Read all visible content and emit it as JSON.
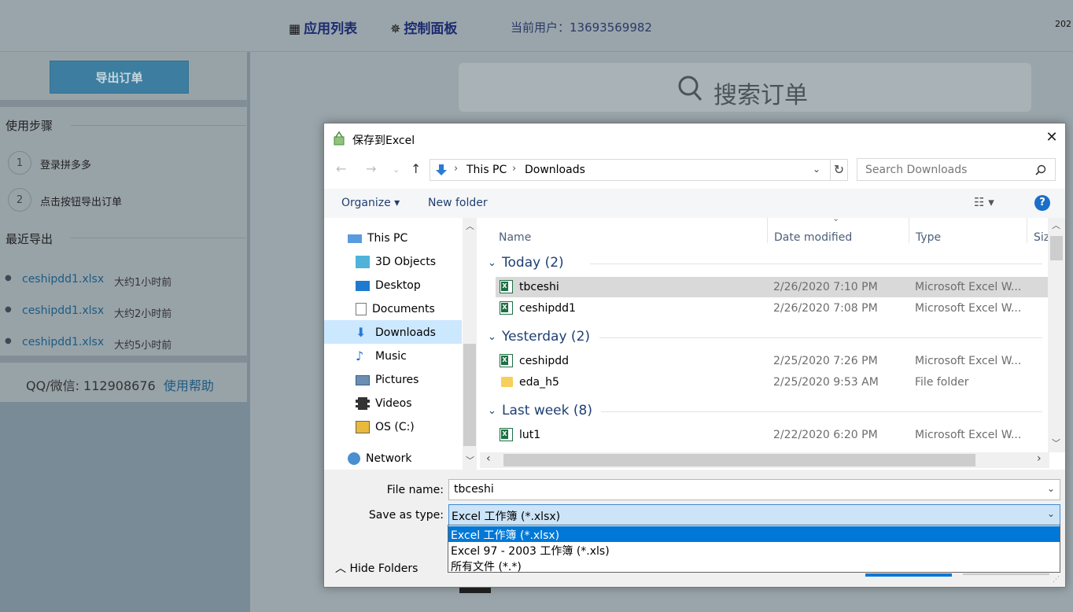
{
  "topbar": {
    "app_list": "应用列表",
    "control_panel": "控制面板",
    "user_label": "当前用户：13693569982",
    "date_clip": "202"
  },
  "sidebar": {
    "export_button": "导出订单",
    "steps_title": "使用步骤",
    "steps": [
      {
        "num": "1",
        "text": "登录拼多多"
      },
      {
        "num": "2",
        "text": "点击按钮导出订单"
      }
    ],
    "recent_title": "最近导出",
    "recent": [
      {
        "file": "ceshipdd1.xlsx",
        "time": "大约1小时前"
      },
      {
        "file": "ceshipdd1.xlsx",
        "time": "大约2小时前"
      },
      {
        "file": "ceshipdd1.xlsx",
        "time": "大约5小时前"
      }
    ],
    "contact": "QQ/微信: 112908676",
    "help": "使用帮助"
  },
  "main": {
    "search_placeholder": "搜索订单"
  },
  "dialog": {
    "title": "保存到Excel",
    "address": {
      "root": "This PC",
      "folder": "Downloads"
    },
    "search_placeholder": "Search Downloads",
    "toolbar": {
      "organize": "Organize ▾",
      "new_folder": "New folder",
      "help": "?"
    },
    "nav": [
      {
        "label": "This PC",
        "icon": "pc-icon"
      },
      {
        "label": "3D Objects",
        "icon": "cube-icon"
      },
      {
        "label": "Desktop",
        "icon": "desktop-icon"
      },
      {
        "label": "Documents",
        "icon": "document-icon"
      },
      {
        "label": "Downloads",
        "icon": "download-icon",
        "selected": true
      },
      {
        "label": "Music",
        "icon": "music-icon"
      },
      {
        "label": "Pictures",
        "icon": "pictures-icon"
      },
      {
        "label": "Videos",
        "icon": "videos-icon"
      },
      {
        "label": "OS (C:)",
        "icon": "drive-icon"
      },
      {
        "label": "Network",
        "icon": "network-icon"
      }
    ],
    "columns": {
      "name": "Name",
      "date": "Date modified",
      "type": "Type",
      "size": "Siz"
    },
    "groups": [
      {
        "label": "Today (2)",
        "rows": [
          {
            "name": "tbceshi",
            "date": "2/26/2020 7:10 PM",
            "type": "Microsoft Excel W...",
            "kind": "excel",
            "selected": true
          },
          {
            "name": "ceshipdd1",
            "date": "2/26/2020 7:08 PM",
            "type": "Microsoft Excel W...",
            "kind": "excel"
          }
        ]
      },
      {
        "label": "Yesterday (2)",
        "rows": [
          {
            "name": "ceshipdd",
            "date": "2/25/2020 7:26 PM",
            "type": "Microsoft Excel W...",
            "kind": "excel"
          },
          {
            "name": "eda_h5",
            "date": "2/25/2020 9:53 AM",
            "type": "File folder",
            "kind": "folder"
          }
        ]
      },
      {
        "label": "Last week (8)",
        "rows": [
          {
            "name": "lut1",
            "date": "2/22/2020 6:20 PM",
            "type": "Microsoft Excel W...",
            "kind": "excel"
          }
        ]
      }
    ],
    "file_name_label": "File name:",
    "file_name": "tbceshi",
    "save_type_label": "Save as type:",
    "save_type": "Excel 工作簿 (*.xlsx)",
    "type_options": [
      "Excel 工作簿 (*.xlsx)",
      "Excel 97 - 2003 工作簿 (*.xls)",
      "所有文件 (*.*)"
    ],
    "hide_folders": "Hide Folders"
  }
}
